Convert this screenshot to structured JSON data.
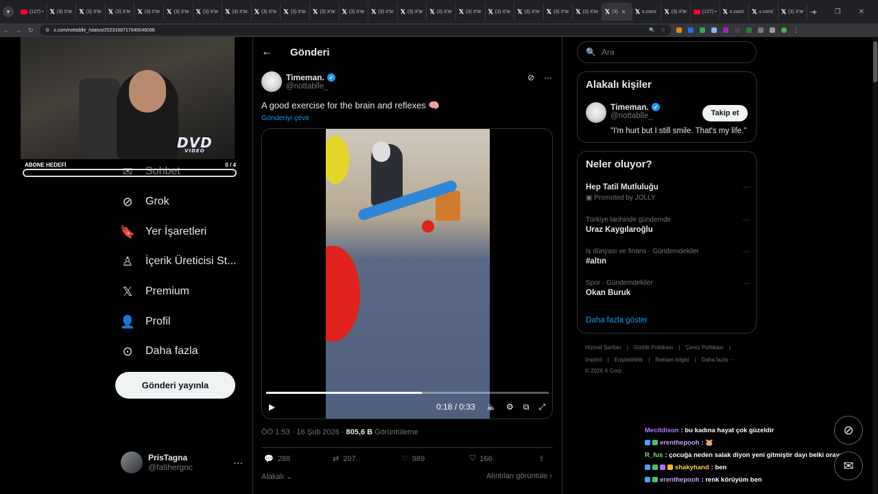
{
  "browser": {
    "tabs": [
      {
        "label": "(127) •",
        "fav": "yt"
      },
      {
        "label": "(3) X'te",
        "fav": "x"
      },
      {
        "label": "(3) X'te",
        "fav": "x"
      },
      {
        "label": "(3) X'te",
        "fav": "x"
      },
      {
        "label": "(3) X'te",
        "fav": "x"
      },
      {
        "label": "(3) X'te",
        "fav": "x"
      },
      {
        "label": "(3) X'te",
        "fav": "x"
      },
      {
        "label": "(3) X'te",
        "fav": "x"
      },
      {
        "label": "(3) X'te",
        "fav": "x"
      },
      {
        "label": "(3) X'te",
        "fav": "x"
      },
      {
        "label": "(3) X'te",
        "fav": "x"
      },
      {
        "label": "(3) X'te",
        "fav": "x"
      },
      {
        "label": "(3) X'te",
        "fav": "x"
      },
      {
        "label": "(3) X'te",
        "fav": "x"
      },
      {
        "label": "(3) X'te",
        "fav": "x"
      },
      {
        "label": "(3) X'te",
        "fav": "x"
      },
      {
        "label": "(3) X'te",
        "fav": "x"
      },
      {
        "label": "(3) X'te",
        "fav": "x"
      },
      {
        "label": "(3) X'te",
        "fav": "x"
      },
      {
        "label": "(3) X'te",
        "fav": "x"
      },
      {
        "label": "(3)",
        "fav": "x",
        "active": true
      },
      {
        "label": "x.com/",
        "fav": "x"
      },
      {
        "label": "(3) X'te",
        "fav": "x"
      },
      {
        "label": "(127) •",
        "fav": "yt"
      },
      {
        "label": "x.com/",
        "fav": "x"
      },
      {
        "label": "x.com/",
        "fav": "x"
      },
      {
        "label": "(3) X'te",
        "fav": "x"
      }
    ],
    "url": "x.com/nottablle_/status/2023168717040046096"
  },
  "stream": {
    "sub_goal_label": "ABONE HEDEFİ",
    "sub_goal_value": "0 / 4",
    "dvd_logo": "DVD",
    "dvd_sub": "VIDEO"
  },
  "nav": {
    "items": [
      {
        "label": "Sohbet",
        "icon": "mail-icon"
      },
      {
        "label": "Grok",
        "icon": "grok-icon"
      },
      {
        "label": "Yer İşaretleri",
        "icon": "bookmark-icon"
      },
      {
        "label": "İçerik Üreticisi St...",
        "icon": "creator-studio-icon"
      },
      {
        "label": "Premium",
        "icon": "x-logo-icon"
      },
      {
        "label": "Profil",
        "icon": "profile-icon"
      },
      {
        "label": "Daha fazla",
        "icon": "more-circle-icon"
      }
    ],
    "post_button": "Gönderi yayınla",
    "account": {
      "name": "PrisTagna",
      "handle": "@fatihergnc",
      "more": "···"
    }
  },
  "post": {
    "header_title": "Gönderi",
    "author_name": "Timeman.",
    "author_handle": "@nottablle_",
    "text": "A good exercise for the brain and reflexes 🧠",
    "translate": "Gönderiyi çevir",
    "video": {
      "time": "0:18 / 0:33",
      "progress": 0.55
    },
    "meta_time": "ÖÖ 1:53 · 16 Şub 2026 · ",
    "views": "805,6 B",
    "views_label": " Görüntüleme",
    "replies": "288",
    "reposts": "207",
    "likes": "989",
    "bookmarks": "166",
    "relevant": "Alakalı",
    "quotes": "Alıntıları görüntüle"
  },
  "sidebar": {
    "search_placeholder": "Ara",
    "relevant_title": "Alakalı kişiler",
    "person_name": "Timeman.",
    "person_handle": "@nottablle_",
    "person_bio": "\"I'm hurt but I still smile. That's my life.\"",
    "follow": "Takip et",
    "trends_title": "Neler oluyor?",
    "trends": [
      {
        "ctx": "",
        "title": "Hep Tatil Mutluluğu",
        "promo": "Promoted by JOLLY"
      },
      {
        "ctx": "Türkiye tarihinde gündemde",
        "title": "Uraz Kaygılaroğlu"
      },
      {
        "ctx": "İş dünyası ve finans · Gündemdekiler",
        "title": "#altın"
      },
      {
        "ctx": "Spor · Gündemdekiler",
        "title": "Okan Buruk"
      }
    ],
    "show_more": "Daha fazla göster",
    "footer_links_1": [
      "Hizmet Şartları",
      "|",
      "Gizlilik Politikası",
      "|",
      "Çerez Politikası",
      "|"
    ],
    "footer_links_2": [
      "Imprint",
      "|",
      "Erişilebilirlik",
      "|",
      "Reklam bilgisi",
      "|",
      "Daha fazla ···"
    ],
    "copyright": "© 2026 X Corp."
  },
  "chat": [
    {
      "user": "Mecitdixon",
      "color": "#b07cff",
      "msg": " : bu kadına hayat çok güzeldir",
      "badges": 0
    },
    {
      "user": "erenthepooh",
      "color": "#c8a0ff",
      "msg": " : 🐹",
      "badges": 2
    },
    {
      "user": "R_fus",
      "color": "#7fe07f",
      "msg": " : çocuğa neden salak diyon yeni gitmiştir dayı belki oraya",
      "badges": 0
    },
    {
      "user": "shakyhand",
      "color": "#ffd23f",
      "msg": " : ben",
      "badges": 4
    },
    {
      "user": "erenthepooh",
      "color": "#c8a0ff",
      "msg": " : renk körüyüm ben",
      "badges": 2
    }
  ],
  "colors": {
    "accent": "#1d9bf0",
    "bg": "#000000",
    "text": "#e7e9ea",
    "muted": "#71767b"
  }
}
